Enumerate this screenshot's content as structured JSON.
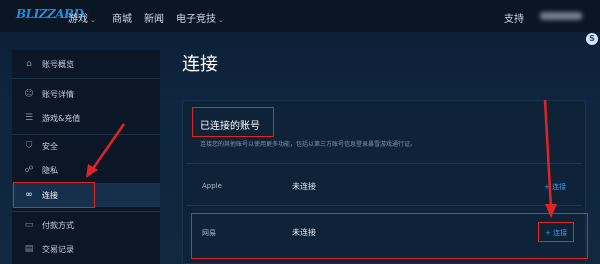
{
  "topnav": {
    "logo": "BLIZZARD",
    "items": [
      {
        "label": "游戏",
        "has_chevron": true
      },
      {
        "label": "商城",
        "has_chevron": false
      },
      {
        "label": "新闻",
        "has_chevron": false
      },
      {
        "label": "电子竞技",
        "has_chevron": true
      }
    ],
    "support": "支持",
    "chevron": "⌄"
  },
  "side_badge": "S",
  "sidebar": {
    "items": [
      {
        "label": "账号概览",
        "icon": "home-icon",
        "glyph": "⌂",
        "active": false
      },
      {
        "label": "账号详情",
        "icon": "user-icon",
        "glyph": "👤",
        "active": false
      },
      {
        "label": "游戏&充值",
        "icon": "list-icon",
        "glyph": "☰",
        "active": false
      },
      {
        "label": "安全",
        "icon": "shield-icon",
        "glyph": "⛉",
        "active": false
      },
      {
        "label": "隐私",
        "icon": "lock-icon",
        "glyph": "🔒",
        "active": false
      },
      {
        "label": "连接",
        "icon": "link-icon",
        "glyph": "🔗",
        "active": true
      },
      {
        "label": "付款方式",
        "icon": "card-icon",
        "glyph": "▭",
        "active": false
      },
      {
        "label": "交易记录",
        "icon": "receipt-icon",
        "glyph": "▤",
        "active": false
      }
    ]
  },
  "main": {
    "title": "连接",
    "panel_title": "已连接的账号",
    "panel_desc": "连接您的其他账号以使用更多功能，包括以第三方账号信息登录暴雪游戏通行证。",
    "rows": [
      {
        "label": "Apple",
        "status": "未连接",
        "action": "+ 连接"
      },
      {
        "label": "网易",
        "status": "未连接",
        "action": "+ 连接"
      }
    ]
  },
  "colors": {
    "accent": "#2f9ef3",
    "annotation": "#e02424",
    "background": "#0f2540"
  }
}
